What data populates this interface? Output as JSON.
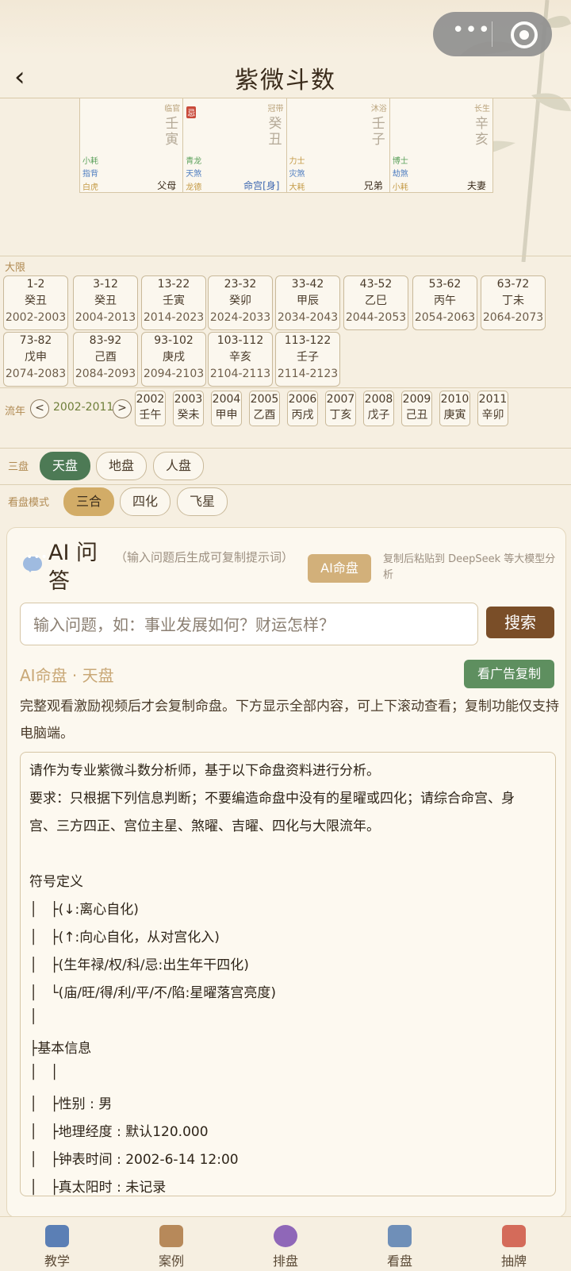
{
  "header": {
    "back": "‹",
    "title": "紫微斗数"
  },
  "palaces": [
    {
      "top": "",
      "state": "临官",
      "gan": [
        "壬",
        "寅"
      ],
      "ji": "",
      "s1": "小耗",
      "s2": "指背",
      "s3": "白虎",
      "name": "父母"
    },
    {
      "top": "",
      "state": "冠带",
      "gan": [
        "癸",
        "丑"
      ],
      "ji": "忌",
      "s1": "青龙",
      "s2": "天煞",
      "s3": "龙德",
      "name": "命宫[身]"
    },
    {
      "top": "",
      "state": "沐浴",
      "gan": [
        "壬",
        "子"
      ],
      "ji": "",
      "s1": "力士",
      "s2": "灾煞",
      "s3": "大耗",
      "name": "兄弟"
    },
    {
      "top": "",
      "state": "长生",
      "gan": [
        "辛",
        "亥"
      ],
      "ji": "",
      "s1": "博士",
      "s2": "劫煞",
      "s3": "小耗",
      "name": "夫妻"
    }
  ],
  "daxian": {
    "label": "大限",
    "items": [
      {
        "age": "1-2",
        "gz": "癸丑",
        "yrs": "2002-2003"
      },
      {
        "age": "3-12",
        "gz": "癸丑",
        "yrs": "2004-2013"
      },
      {
        "age": "13-22",
        "gz": "壬寅",
        "yrs": "2014-2023"
      },
      {
        "age": "23-32",
        "gz": "癸卯",
        "yrs": "2024-2033"
      },
      {
        "age": "33-42",
        "gz": "甲辰",
        "yrs": "2034-2043"
      },
      {
        "age": "43-52",
        "gz": "乙巳",
        "yrs": "2044-2053"
      },
      {
        "age": "53-62",
        "gz": "丙午",
        "yrs": "2054-2063"
      },
      {
        "age": "63-72",
        "gz": "丁未",
        "yrs": "2064-2073"
      },
      {
        "age": "73-82",
        "gz": "戊申",
        "yrs": "2074-2083"
      },
      {
        "age": "83-92",
        "gz": "己酉",
        "yrs": "2084-2093"
      },
      {
        "age": "93-102",
        "gz": "庚戌",
        "yrs": "2094-2103"
      },
      {
        "age": "103-112",
        "gz": "辛亥",
        "yrs": "2104-2113"
      },
      {
        "age": "113-122",
        "gz": "壬子",
        "yrs": "2114-2123"
      }
    ]
  },
  "liunian": {
    "label": "流年",
    "prev": "<",
    "range": "2002-2011",
    "next": ">",
    "years": [
      {
        "y": "2002",
        "gz": "壬午"
      },
      {
        "y": "2003",
        "gz": "癸未"
      },
      {
        "y": "2004",
        "gz": "甲申"
      },
      {
        "y": "2005",
        "gz": "乙酉"
      },
      {
        "y": "2006",
        "gz": "丙戌"
      },
      {
        "y": "2007",
        "gz": "丁亥"
      },
      {
        "y": "2008",
        "gz": "戊子"
      },
      {
        "y": "2009",
        "gz": "己丑"
      },
      {
        "y": "2010",
        "gz": "庚寅"
      },
      {
        "y": "2011",
        "gz": "辛卯"
      }
    ]
  },
  "sanpan": {
    "label": "三盘",
    "options": [
      "天盘",
      "地盘",
      "人盘"
    ],
    "selected": "天盘"
  },
  "mode": {
    "label": "看盘模式",
    "options": [
      "三合",
      "四化",
      "飞星"
    ],
    "selected": "三合"
  },
  "ai": {
    "title": "AI 问答",
    "hint": "（输入问题后生成可复制提示词）",
    "btn": "AI命盘",
    "tip": "复制后粘贴到 DeepSeek 等大模型分析",
    "placeholder": "输入问题，如：事业发展如何？财运怎样？",
    "search": "搜索",
    "subtitle": "AI命盘 · 天盘",
    "copy": "看广告复制",
    "desc": "完整观看激励视频后才会复制命盘。下方显示全部内容，可上下滚动查看；复制功能仅支持电脑端。",
    "lines": [
      "请作为专业紫微斗数分析师，基于以下命盘资料进行分析。",
      "要求：只根据下列信息判断；不要编造命盘中没有的星曜或四化；请综合命宫、身",
      "宫、三方四正、宫位主星、煞曜、吉曜、四化与大限流年。",
      "",
      "符号定义",
      "│   ├(↓:离心自化)",
      "│   ├(↑:向心自化，从对宫化入)",
      "│   ├(生年禄/权/科/忌:出生年干四化)",
      "│   └(庙/旺/得/利/平/不/陷:星曜落宫亮度)",
      "│",
      "├基本信息",
      "│   │",
      "│   ├性别 : 男",
      "│   ├地理经度 : 默认120.000",
      "│   ├钟表时间 : 2002-6-14 12:00",
      "│   ├真太阳时 : 未记录"
    ]
  },
  "tabs": [
    {
      "label": "教学",
      "icon": "book-icon",
      "color": "#5b7fb5"
    },
    {
      "label": "案例",
      "icon": "clipboard-icon",
      "color": "#b7895a"
    },
    {
      "label": "排盘",
      "icon": "crystal-ball-icon",
      "color": "#8f67b8"
    },
    {
      "label": "看盘",
      "icon": "bar-chart-icon",
      "color": "#6f8fb8"
    },
    {
      "label": "抽牌",
      "icon": "joker-card-icon",
      "color": "#d46b5a"
    }
  ]
}
